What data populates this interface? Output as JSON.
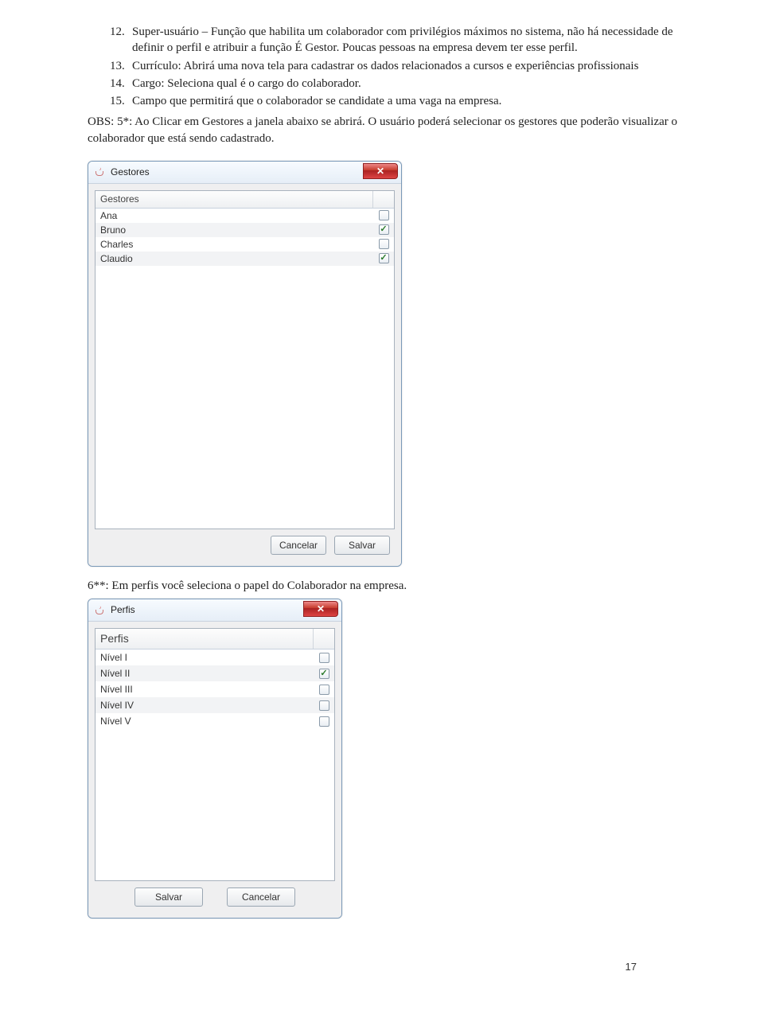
{
  "list": [
    {
      "num": "12.",
      "text": "Super-usuário – Função que habilita um colaborador com privilégios máximos no sistema, não há necessidade de definir o perfil e atribuir a função É Gestor. Poucas pessoas na empresa devem ter esse perfil."
    },
    {
      "num": "13.",
      "text": "Currículo: Abrirá uma nova tela para cadastrar os dados relacionados a cursos e experiências profissionais"
    },
    {
      "num": "14.",
      "text": "Cargo: Seleciona qual é o cargo do colaborador."
    },
    {
      "num": "15.",
      "text": "Campo que permitirá que o colaborador se candidate a uma vaga na empresa."
    }
  ],
  "obs_text": "OBS: 5*: Ao Clicar em Gestores a janela abaixo se abrirá. O usuário poderá selecionar os gestores que poderão visualizar o colaborador que está sendo cadastrado.",
  "gestores": {
    "title": "Gestores",
    "header": "Gestores",
    "rows": [
      {
        "name": "Ana",
        "checked": false
      },
      {
        "name": "Bruno",
        "checked": true
      },
      {
        "name": "Charles",
        "checked": false
      },
      {
        "name": "Claudio",
        "checked": true
      }
    ],
    "actions": {
      "cancel": "Cancelar",
      "save": "Salvar"
    }
  },
  "caption_perfis": "6**: Em perfis você seleciona o papel do Colaborador na empresa.",
  "perfis": {
    "title": "Perfis",
    "header": "Perfis",
    "rows": [
      {
        "name": "Nível I",
        "checked": false
      },
      {
        "name": "Nível II",
        "checked": true
      },
      {
        "name": "Nível III",
        "checked": false
      },
      {
        "name": "Nível IV",
        "checked": false
      },
      {
        "name": "Nível V",
        "checked": false
      }
    ],
    "actions": {
      "save": "Salvar",
      "cancel": "Cancelar"
    }
  },
  "page_number": "17"
}
